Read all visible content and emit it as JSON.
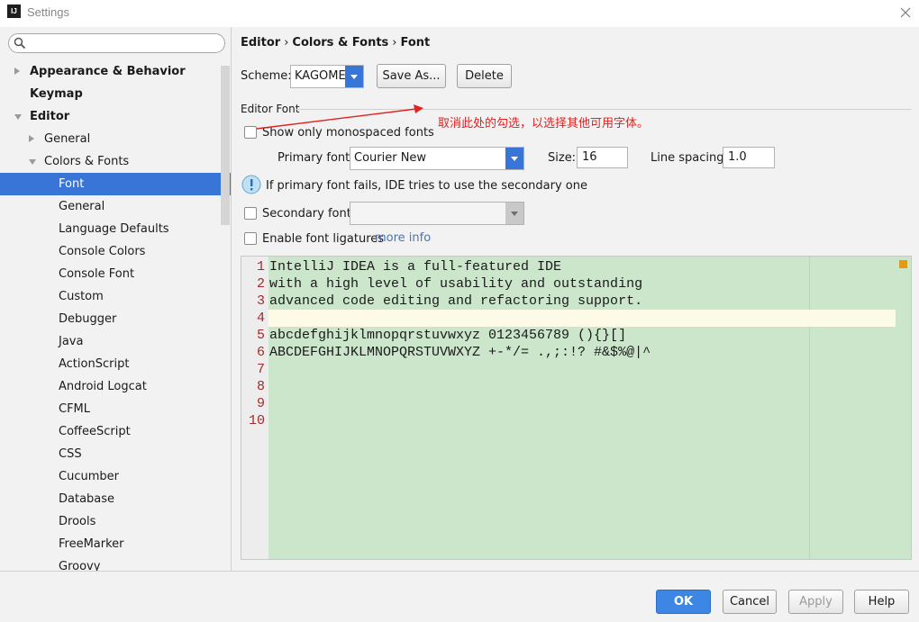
{
  "window": {
    "app_icon": "IJ",
    "title": "Settings",
    "close_icon": "close-icon"
  },
  "sidebar": {
    "search_placeholder": "",
    "items": [
      {
        "label": "Appearance & Behavior",
        "bold": true,
        "arrow": "right",
        "selected": false
      },
      {
        "label": "Keymap",
        "bold": true,
        "arrow": "none",
        "selected": false
      },
      {
        "label": "Editor",
        "bold": true,
        "arrow": "down",
        "selected": false
      },
      {
        "label": "General",
        "bold": false,
        "arrow": "right",
        "selected": false
      },
      {
        "label": "Colors & Fonts",
        "bold": false,
        "arrow": "down",
        "selected": false
      },
      {
        "label": "Font",
        "bold": false,
        "arrow": "none",
        "selected": true
      },
      {
        "label": "General",
        "bold": false,
        "arrow": "none",
        "selected": false
      },
      {
        "label": "Language Defaults",
        "bold": false,
        "arrow": "none",
        "selected": false
      },
      {
        "label": "Console Colors",
        "bold": false,
        "arrow": "none",
        "selected": false
      },
      {
        "label": "Console Font",
        "bold": false,
        "arrow": "none",
        "selected": false
      },
      {
        "label": "Custom",
        "bold": false,
        "arrow": "none",
        "selected": false
      },
      {
        "label": "Debugger",
        "bold": false,
        "arrow": "none",
        "selected": false
      },
      {
        "label": "Java",
        "bold": false,
        "arrow": "none",
        "selected": false
      },
      {
        "label": "ActionScript",
        "bold": false,
        "arrow": "none",
        "selected": false
      },
      {
        "label": "Android Logcat",
        "bold": false,
        "arrow": "none",
        "selected": false
      },
      {
        "label": "CFML",
        "bold": false,
        "arrow": "none",
        "selected": false
      },
      {
        "label": "CoffeeScript",
        "bold": false,
        "arrow": "none",
        "selected": false
      },
      {
        "label": "CSS",
        "bold": false,
        "arrow": "none",
        "selected": false
      },
      {
        "label": "Cucumber",
        "bold": false,
        "arrow": "none",
        "selected": false
      },
      {
        "label": "Database",
        "bold": false,
        "arrow": "none",
        "selected": false
      },
      {
        "label": "Drools",
        "bold": false,
        "arrow": "none",
        "selected": false
      },
      {
        "label": "FreeMarker",
        "bold": false,
        "arrow": "none",
        "selected": false
      },
      {
        "label": "Groovy",
        "bold": false,
        "arrow": "none",
        "selected": false
      }
    ]
  },
  "breadcrumb": {
    "part1": "Editor",
    "sep1": "›",
    "part2": "Colors & Fonts",
    "sep2": "›",
    "part3": "Font"
  },
  "scheme": {
    "label": "Scheme:",
    "value": "KAGOME",
    "save_as": "Save As...",
    "delete": "Delete"
  },
  "editor_font": {
    "section_title": "Editor Font",
    "show_mono_label": "Show only monospaced fonts",
    "show_mono_checked": false,
    "primary_font_label": "Primary font:",
    "primary_font_value": "Courier New",
    "size_label": "Size:",
    "size_value": "16",
    "line_spacing_label": "Line spacing:",
    "line_spacing_value": "1.0",
    "info_text": "If primary font fails, IDE tries to use the secondary one",
    "secondary_font_label": "Secondary font:",
    "secondary_font_value": "",
    "secondary_checked": false,
    "ligatures_label": "Enable font ligatures",
    "ligatures_checked": false,
    "more_info": "more info"
  },
  "annotation": {
    "text": "取消此处的勾选，以选择其他可用字体。",
    "color": "#e32121"
  },
  "preview": {
    "lines": [
      {
        "num": "1",
        "code": "IntelliJ IDEA is a full-featured IDE"
      },
      {
        "num": "2",
        "code": "with a high level of usability and outstanding"
      },
      {
        "num": "3",
        "code": "advanced code editing and refactoring support."
      },
      {
        "num": "4",
        "code": ""
      },
      {
        "num": "5",
        "code": "abcdefghijklmnopqrstuvwxyz 0123456789 (){}[]"
      },
      {
        "num": "6",
        "code": "ABCDEFGHIJKLMNOPQRSTUVWXYZ +-*/= .,;:!? #&$%@|^"
      },
      {
        "num": "7",
        "code": ""
      },
      {
        "num": "8",
        "code": ""
      },
      {
        "num": "9",
        "code": ""
      },
      {
        "num": "10",
        "code": ""
      }
    ],
    "current_line": 4,
    "background": "#cce6cc"
  },
  "footer": {
    "ok": "OK",
    "cancel": "Cancel",
    "apply": "Apply",
    "help": "Help"
  },
  "colors": {
    "accent": "#3875d7",
    "annotation": "#e32121",
    "link": "#4a74b8"
  }
}
